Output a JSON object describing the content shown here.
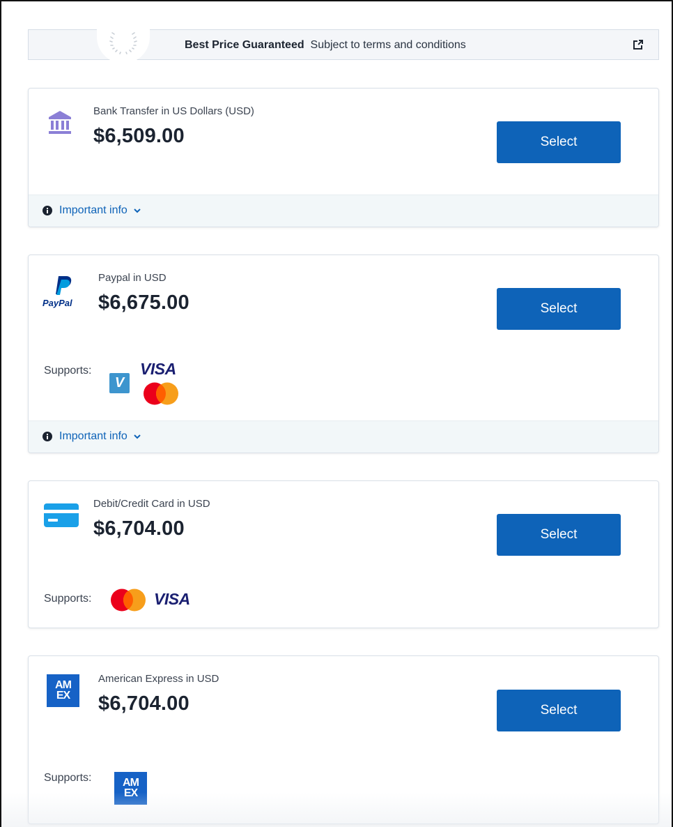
{
  "banner": {
    "title": "Best Price Guaranteed",
    "subtitle": "Subject to terms and conditions",
    "icon": "external-link-icon"
  },
  "methods": [
    {
      "icon": "bank-icon",
      "label": "Bank Transfer in US Dollars (USD)",
      "price": "$6,509.00",
      "button": "Select",
      "info": "Important info"
    },
    {
      "icon": "paypal-logo",
      "logo_text": "PayPal",
      "label": "Paypal in USD",
      "price": "$6,675.00",
      "button": "Select",
      "supports_label": "Supports:",
      "supports": [
        "venmo",
        "visa",
        "mastercard"
      ],
      "venmo_text": "V",
      "visa_text": "VISA",
      "info": "Important info"
    },
    {
      "icon": "credit-card-icon",
      "label": "Debit/Credit Card in USD",
      "price": "$6,704.00",
      "button": "Select",
      "supports_label": "Supports:",
      "supports": [
        "mastercard",
        "visa"
      ],
      "visa_text": "VISA"
    },
    {
      "icon": "amex-logo",
      "logo_text_top": "AM",
      "logo_text_bottom": "EX",
      "label": "American Express in USD",
      "price": "$6,704.00",
      "button": "Select",
      "supports_label": "Supports:",
      "supports": [
        "amex"
      ]
    }
  ],
  "colors": {
    "accent": "#0e63b8",
    "bank_icon": "#8b7fd6",
    "card_icon": "#1aa0e8",
    "amex": "#1662c6",
    "visa": "#1a1f71",
    "mc_red": "#eb001b",
    "mc_orange": "#f79e1b",
    "venmo": "#3d95ce"
  }
}
